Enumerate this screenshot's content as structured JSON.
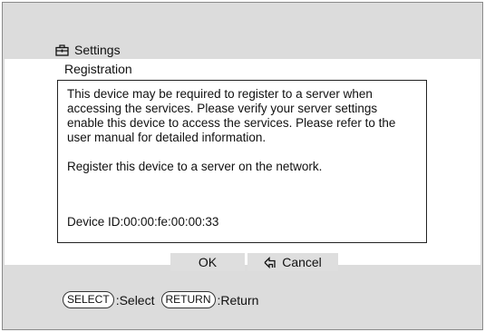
{
  "header": {
    "title": "Settings",
    "title_icon": "toolbox-icon"
  },
  "dialog": {
    "subtitle": "Registration",
    "paragraph1": "This device may be required to register to a server when accessing the services.  Please verify your server settings enable this device to access the services.  Please refer to the user manual for detailed information.",
    "paragraph2": "Register this device to a server on the network.",
    "device_id": "Device ID:00:00:fe:00:00:33"
  },
  "buttons": {
    "ok_label": "OK",
    "cancel_label": "Cancel",
    "cancel_icon": "return-arrow-icon"
  },
  "footer": {
    "select_key": "SELECT",
    "select_label": ":Select",
    "return_key": "RETURN",
    "return_label": ":Return"
  },
  "colors": {
    "background": "#dcdcdc",
    "panel": "#ffffff",
    "button": "#dedede"
  }
}
